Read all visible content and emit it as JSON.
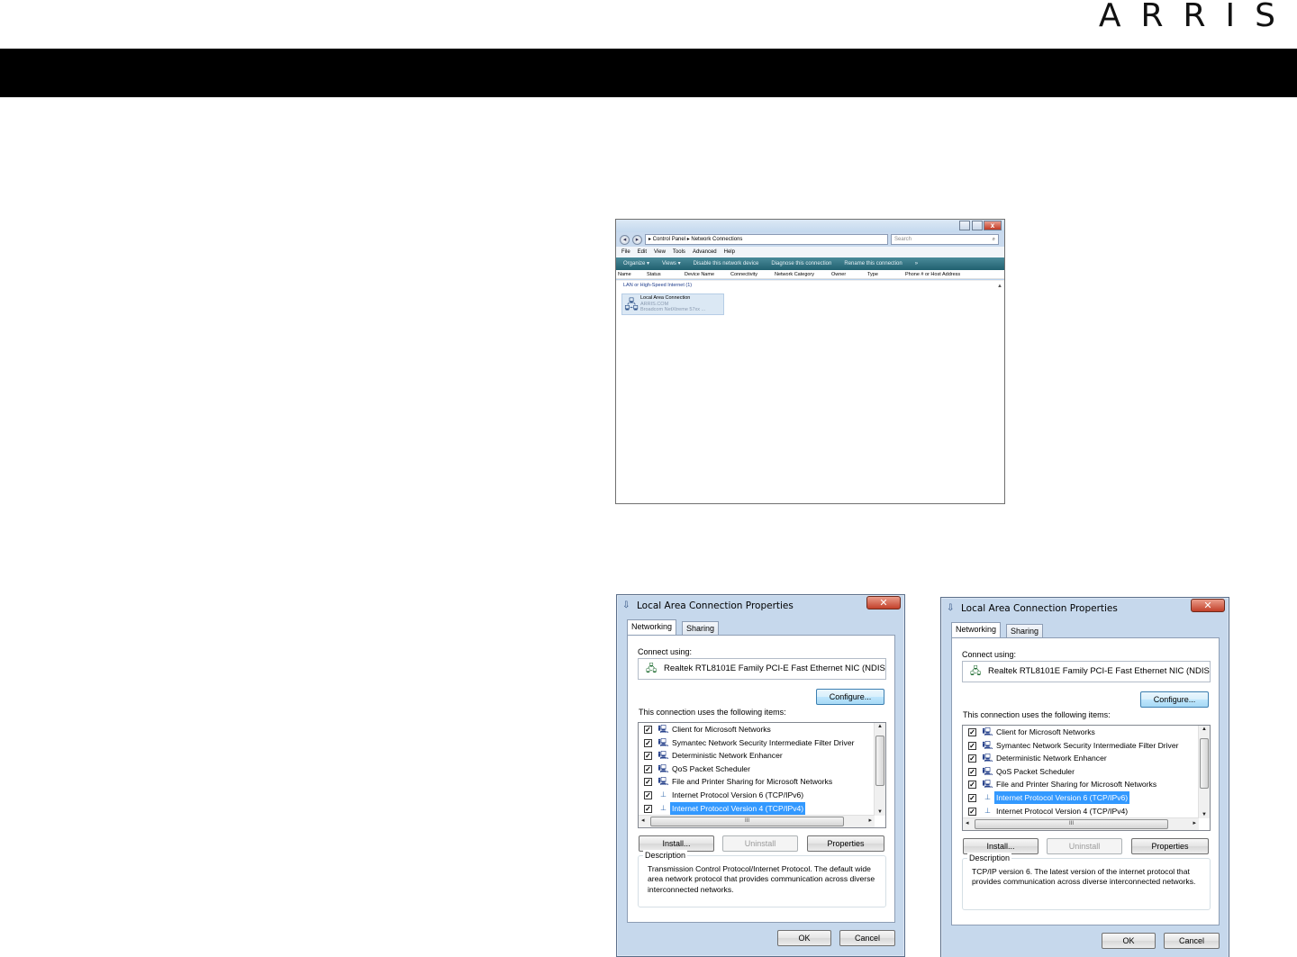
{
  "header": {
    "logo": "ARRIS",
    "bar_color": "#000000"
  },
  "explorer": {
    "address": "▸ Control Panel ▸ Network Connections",
    "search_placeholder": "Search",
    "menu": [
      "File",
      "Edit",
      "View",
      "Tools",
      "Advanced",
      "Help"
    ],
    "toolbar": [
      "Organize ▾",
      "Views ▾",
      "Disable this network device",
      "Diagnose this connection",
      "Rename this connection",
      "»"
    ],
    "columns": [
      "Name",
      "Status",
      "Device Name",
      "Connectivity",
      "Network Category",
      "Owner",
      "Type",
      "Phone # or Host Address"
    ],
    "group_label": "LAN or High-Speed Internet (1)",
    "item": {
      "name": "Local Area Connection",
      "status": "ARRIS.COM",
      "device": "Broadcom NetXtreme 57xx ..."
    }
  },
  "dialogs": [
    {
      "title": "Local Area Connection Properties",
      "tabs": [
        "Networking",
        "Sharing"
      ],
      "connect_using_label": "Connect using:",
      "adapter": "Realtek RTL8101E Family PCI-E Fast Ethernet NIC (NDIS",
      "configure_label": "Configure...",
      "items_label": "This connection uses the following items:",
      "items": [
        {
          "label": "Client for Microsoft Networks",
          "checked": true,
          "icon": "network-client-icon",
          "selected": false
        },
        {
          "label": "Symantec Network Security Intermediate Filter Driver",
          "checked": true,
          "icon": "network-service-icon",
          "selected": false
        },
        {
          "label": "Deterministic Network Enhancer",
          "checked": true,
          "icon": "network-service-icon",
          "selected": false
        },
        {
          "label": "QoS Packet Scheduler",
          "checked": true,
          "icon": "network-service-icon",
          "selected": false
        },
        {
          "label": "File and Printer Sharing for Microsoft Networks",
          "checked": true,
          "icon": "network-service-icon",
          "selected": false
        },
        {
          "label": "Internet Protocol Version 6 (TCP/IPv6)",
          "checked": true,
          "icon": "protocol-icon",
          "selected": false
        },
        {
          "label": "Internet Protocol Version 4 (TCP/IPv4)",
          "checked": true,
          "icon": "protocol-icon",
          "selected": true
        }
      ],
      "install_label": "Install...",
      "uninstall_label": "Uninstall",
      "properties_label": "Properties",
      "description_label": "Description",
      "description": "Transmission Control Protocol/Internet Protocol. The default wide area network protocol that provides communication across diverse interconnected networks.",
      "ok_label": "OK",
      "cancel_label": "Cancel",
      "scroll_mark": "III"
    },
    {
      "title": "Local Area Connection Properties",
      "tabs": [
        "Networking",
        "Sharing"
      ],
      "connect_using_label": "Connect using:",
      "adapter": "Realtek RTL8101E Family PCI-E Fast Ethernet NIC (NDIS",
      "configure_label": "Configure...",
      "items_label": "This connection uses the following items:",
      "items": [
        {
          "label": "Client for Microsoft Networks",
          "checked": true,
          "icon": "network-client-icon",
          "selected": false
        },
        {
          "label": "Symantec Network Security Intermediate Filter Driver",
          "checked": true,
          "icon": "network-service-icon",
          "selected": false
        },
        {
          "label": "Deterministic Network Enhancer",
          "checked": true,
          "icon": "network-service-icon",
          "selected": false
        },
        {
          "label": "QoS Packet Scheduler",
          "checked": true,
          "icon": "network-service-icon",
          "selected": false
        },
        {
          "label": "File and Printer Sharing for Microsoft Networks",
          "checked": true,
          "icon": "network-service-icon",
          "selected": false
        },
        {
          "label": "Internet Protocol Version 6 (TCP/IPv6)",
          "checked": true,
          "icon": "protocol-icon",
          "selected": true
        },
        {
          "label": "Internet Protocol Version 4 (TCP/IPv4)",
          "checked": true,
          "icon": "protocol-icon",
          "selected": false
        }
      ],
      "install_label": "Install...",
      "uninstall_label": "Uninstall",
      "properties_label": "Properties",
      "description_label": "Description",
      "description": "TCP/IP version 6. The latest version of the internet protocol that provides communication across diverse interconnected networks.",
      "ok_label": "OK",
      "cancel_label": "Cancel",
      "scroll_mark": "III"
    }
  ]
}
